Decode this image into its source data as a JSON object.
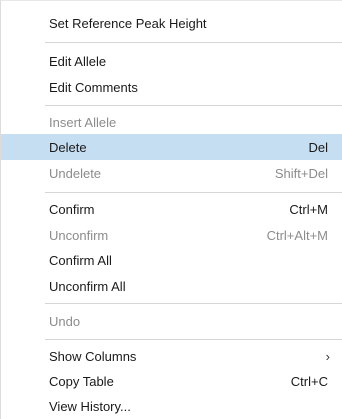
{
  "menu": {
    "items": [
      {
        "label": "Set Reference Peak Height",
        "shortcut": "",
        "disabled": false,
        "highlighted": false
      },
      {
        "label": "Edit Allele",
        "shortcut": "",
        "disabled": false,
        "highlighted": false
      },
      {
        "label": "Edit Comments",
        "shortcut": "",
        "disabled": false,
        "highlighted": false
      },
      {
        "label": "Insert Allele",
        "shortcut": "",
        "disabled": true,
        "highlighted": false
      },
      {
        "label": "Delete",
        "shortcut": "Del",
        "disabled": false,
        "highlighted": true
      },
      {
        "label": "Undelete",
        "shortcut": "Shift+Del",
        "disabled": true,
        "highlighted": false
      },
      {
        "label": "Confirm",
        "shortcut": "Ctrl+M",
        "disabled": false,
        "highlighted": false
      },
      {
        "label": "Unconfirm",
        "shortcut": "Ctrl+Alt+M",
        "disabled": true,
        "highlighted": false
      },
      {
        "label": "Confirm All",
        "shortcut": "",
        "disabled": false,
        "highlighted": false
      },
      {
        "label": "Unconfirm All",
        "shortcut": "",
        "disabled": false,
        "highlighted": false
      },
      {
        "label": "Undo",
        "shortcut": "",
        "disabled": true,
        "highlighted": false
      },
      {
        "label": "Show Columns",
        "shortcut": "",
        "disabled": false,
        "highlighted": false,
        "submenu_icon": "chevron-right-icon"
      },
      {
        "label": "Copy Table",
        "shortcut": "Ctrl+C",
        "disabled": false,
        "highlighted": false
      },
      {
        "label": "View History...",
        "shortcut": "",
        "disabled": false,
        "highlighted": false
      }
    ],
    "colors": {
      "highlight": "#c6def2",
      "disabled_text": "#8c8c8c",
      "separator": "#d6d6d6"
    }
  }
}
